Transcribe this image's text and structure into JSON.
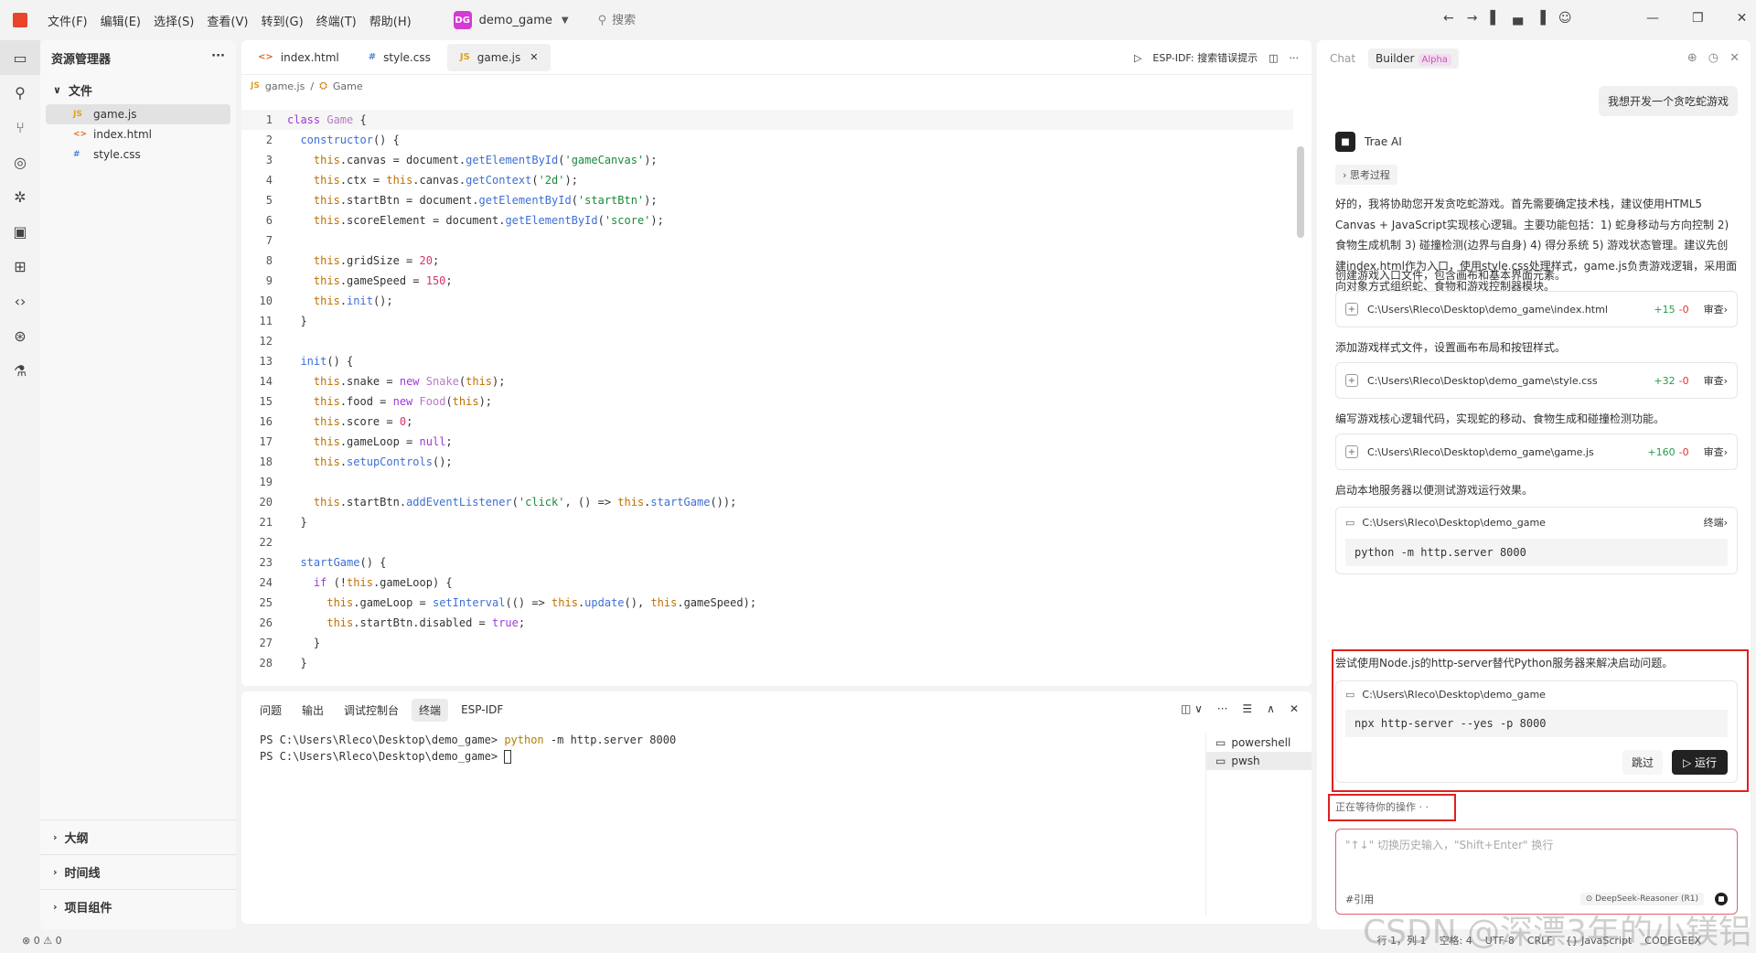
{
  "titlebar": {
    "menus": [
      "文件(F)",
      "编辑(E)",
      "选择(S)",
      "查看(V)",
      "转到(G)",
      "终端(T)",
      "帮助(H)"
    ],
    "project_badge": "DG",
    "project_name": "demo_game",
    "search_placeholder": "搜索"
  },
  "explorer": {
    "title": "资源管理器",
    "section": "文件",
    "files": [
      {
        "icon": "JS",
        "name": "game.js"
      },
      {
        "icon": "<>",
        "name": "index.html"
      },
      {
        "icon": "#",
        "name": "style.css"
      }
    ],
    "bottom_sections": [
      "大纲",
      "时间线",
      "项目组件"
    ]
  },
  "editor": {
    "tabs": [
      {
        "icon": "<>",
        "label": "index.html"
      },
      {
        "icon": "#",
        "label": "style.css"
      },
      {
        "icon": "JS",
        "label": "game.js"
      }
    ],
    "actions_label": "ESP-IDF: 搜索错误提示",
    "breadcrumb": [
      "game.js",
      "Game"
    ],
    "lines": [
      "class Game {",
      "  constructor() {",
      "    this.canvas = document.getElementById('gameCanvas');",
      "    this.ctx = this.canvas.getContext('2d');",
      "    this.startBtn = document.getElementById('startBtn');",
      "    this.scoreElement = document.getElementById('score');",
      "",
      "    this.gridSize = 20;",
      "    this.gameSpeed = 150;",
      "    this.init();",
      "  }",
      "",
      "  init() {",
      "    this.snake = new Snake(this);",
      "    this.food = new Food(this);",
      "    this.score = 0;",
      "    this.gameLoop = null;",
      "    this.setupControls();",
      "",
      "    this.startBtn.addEventListener('click', () => this.startGame());",
      "  }",
      "",
      "  startGame() {",
      "    if (!this.gameLoop) {",
      "      this.gameLoop = setInterval(() => this.update(), this.gameSpeed);",
      "      this.startBtn.disabled = true;",
      "    }",
      "  }"
    ]
  },
  "panel": {
    "tabs": [
      "问题",
      "输出",
      "调试控制台",
      "终端",
      "ESP-IDF"
    ],
    "terminal_lines": [
      {
        "prompt": "PS C:\\Users\\Rleco\\Desktop\\demo_game> ",
        "cmd": "python",
        "args": " -m http.server 8000"
      },
      {
        "prompt": "PS C:\\Users\\Rleco\\Desktop\\demo_game> ",
        "cmd": "",
        "args": ""
      }
    ],
    "terminals": [
      "powershell",
      "pwsh"
    ]
  },
  "status": {
    "problems": "0",
    "warnings": "0",
    "position": "行 1，列 1",
    "spaces": "空格: 4",
    "encoding": "UTF-8",
    "eol": "CRLF",
    "language": "{} JavaScript",
    "ext": "CODEGEEX"
  },
  "chat": {
    "tab_chat": "Chat",
    "tab_builder": "Builder",
    "alpha": "Alpha",
    "user_msg": "我想开发一个贪吃蛇游戏",
    "ai_name": "Trae AI",
    "thinking": "思考过程",
    "intro": "好的，我将协助您开发贪吃蛇游戏。首先需要确定技术栈，建议使用HTML5 Canvas + JavaScript实现核心逻辑。主要功能包括：1) 蛇身移动与方向控制 2) 食物生成机制 3) 碰撞检测(边界与自身) 4) 得分系统 5) 游戏状态管理。建议先创建index.html作为入口，使用style.css处理样式，game.js负责游戏逻辑，采用面向对象方式组织蛇、食物和游戏控制器模块。",
    "step1": "创建游戏入口文件，包含画布和基本界面元素。",
    "file1": {
      "path": "C:\\Users\\Rleco\\Desktop\\demo_game\\index.html",
      "add": "+15",
      "del": "-0",
      "review": "审查"
    },
    "step2": "添加游戏样式文件，设置画布布局和按钮样式。",
    "file2": {
      "path": "C:\\Users\\Rleco\\Desktop\\demo_game\\style.css",
      "add": "+32",
      "del": "-0",
      "review": "审查"
    },
    "step3": "编写游戏核心逻辑代码，实现蛇的移动、食物生成和碰撞检测功能。",
    "file3": {
      "path": "C:\\Users\\Rleco\\Desktop\\demo_game\\game.js",
      "add": "+160",
      "del": "-0",
      "review": "审查"
    },
    "step4": "启动本地服务器以便测试游戏运行效果。",
    "term1": {
      "path": "C:\\Users\\Rleco\\Desktop\\demo_game",
      "label": "终端",
      "cmd": "python -m http.server 8000"
    },
    "step5": "尝试使用Node.js的http-server替代Python服务器来解决启动问题。",
    "term2": {
      "path": "C:\\Users\\Rleco\\Desktop\\demo_game",
      "cmd": "npx http-server --yes -p 8000",
      "skip": "跳过",
      "run": "▷ 运行"
    },
    "waiting": "正在等待你的操作 · ·",
    "input_placeholder": "\"↑↓\" 切换历史输入，\"Shift+Enter\" 换行",
    "ref": "#引用",
    "model": "DeepSeek-Reasoner (R1)"
  },
  "watermark": "CSDN @深漂3年的小镁铝"
}
